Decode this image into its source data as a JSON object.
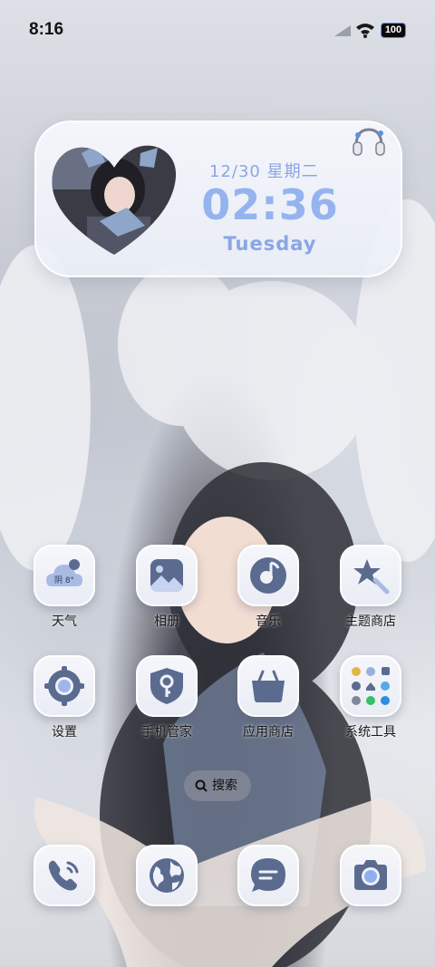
{
  "status_bar": {
    "time": "8:16",
    "battery": "100"
  },
  "widget": {
    "date": "12/30 星期二",
    "time": "02:36",
    "day": "Tuesday"
  },
  "apps": [
    {
      "label": "天气",
      "badge": "阴 8°"
    },
    {
      "label": "相册"
    },
    {
      "label": "音乐"
    },
    {
      "label": "主题商店"
    },
    {
      "label": "设置"
    },
    {
      "label": "手机管家"
    },
    {
      "label": "应用商店"
    },
    {
      "label": "系统工具"
    }
  ],
  "search": {
    "label": "搜索"
  },
  "dock": [
    "phone-icon",
    "browser-icon",
    "messages-icon",
    "camera-icon"
  ],
  "colors": {
    "icon": "#5b6b90",
    "accent": "#95b3ef",
    "tile": "#eef0f6"
  }
}
